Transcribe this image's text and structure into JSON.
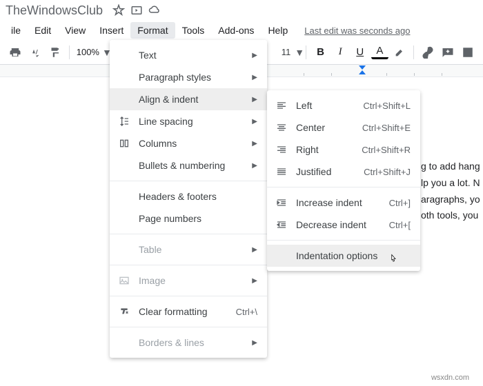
{
  "title": "TheWindowsClub",
  "menubar": {
    "items": [
      "ile",
      "Edit",
      "View",
      "Insert",
      "Format",
      "Tools",
      "Add-ons",
      "Help"
    ],
    "active_index": 4,
    "last_edit": "Last edit was seconds ago"
  },
  "toolbar": {
    "zoom": "100%",
    "font_size": "11"
  },
  "format_menu": [
    {
      "label": "Text",
      "arrow": true,
      "icon": ""
    },
    {
      "label": "Paragraph styles",
      "arrow": true,
      "icon": ""
    },
    {
      "label": "Align & indent",
      "arrow": true,
      "icon": "",
      "highlighted": true
    },
    {
      "label": "Line spacing",
      "arrow": true,
      "icon": "line-spacing"
    },
    {
      "label": "Columns",
      "arrow": true,
      "icon": "columns"
    },
    {
      "label": "Bullets & numbering",
      "arrow": true,
      "icon": ""
    },
    {
      "sep": true
    },
    {
      "label": "Headers & footers",
      "icon": ""
    },
    {
      "label": "Page numbers",
      "icon": ""
    },
    {
      "sep": true
    },
    {
      "label": "Table",
      "arrow": true,
      "icon": "",
      "disabled": true
    },
    {
      "sep": true
    },
    {
      "label": "Image",
      "arrow": true,
      "icon": "image",
      "disabled": true
    },
    {
      "sep": true
    },
    {
      "label": "Clear formatting",
      "icon": "clear",
      "shortcut": "Ctrl+\\"
    },
    {
      "sep": true
    },
    {
      "label": "Borders & lines",
      "arrow": true,
      "icon": "",
      "disabled": true
    }
  ],
  "align_menu": [
    {
      "label": "Left",
      "icon": "align-left",
      "shortcut": "Ctrl+Shift+L"
    },
    {
      "label": "Center",
      "icon": "align-center",
      "shortcut": "Ctrl+Shift+E"
    },
    {
      "label": "Right",
      "icon": "align-right",
      "shortcut": "Ctrl+Shift+R"
    },
    {
      "label": "Justified",
      "icon": "align-justify",
      "shortcut": "Ctrl+Shift+J"
    },
    {
      "sep": true
    },
    {
      "label": "Increase indent",
      "icon": "indent-inc",
      "shortcut": "Ctrl+]"
    },
    {
      "label": "Decrease indent",
      "icon": "indent-dec",
      "shortcut": "Ctrl+["
    },
    {
      "sep": true
    },
    {
      "label": "Indentation options",
      "icon": "",
      "highlighted": true
    }
  ],
  "doc_text": {
    "l1": "g to add hang",
    "l2": "lp you a lot. N",
    "l3": "aragraphs, yo",
    "l4": "oth tools, you"
  },
  "watermark": "TheWindowsClub",
  "footer": "wsxdn.com"
}
